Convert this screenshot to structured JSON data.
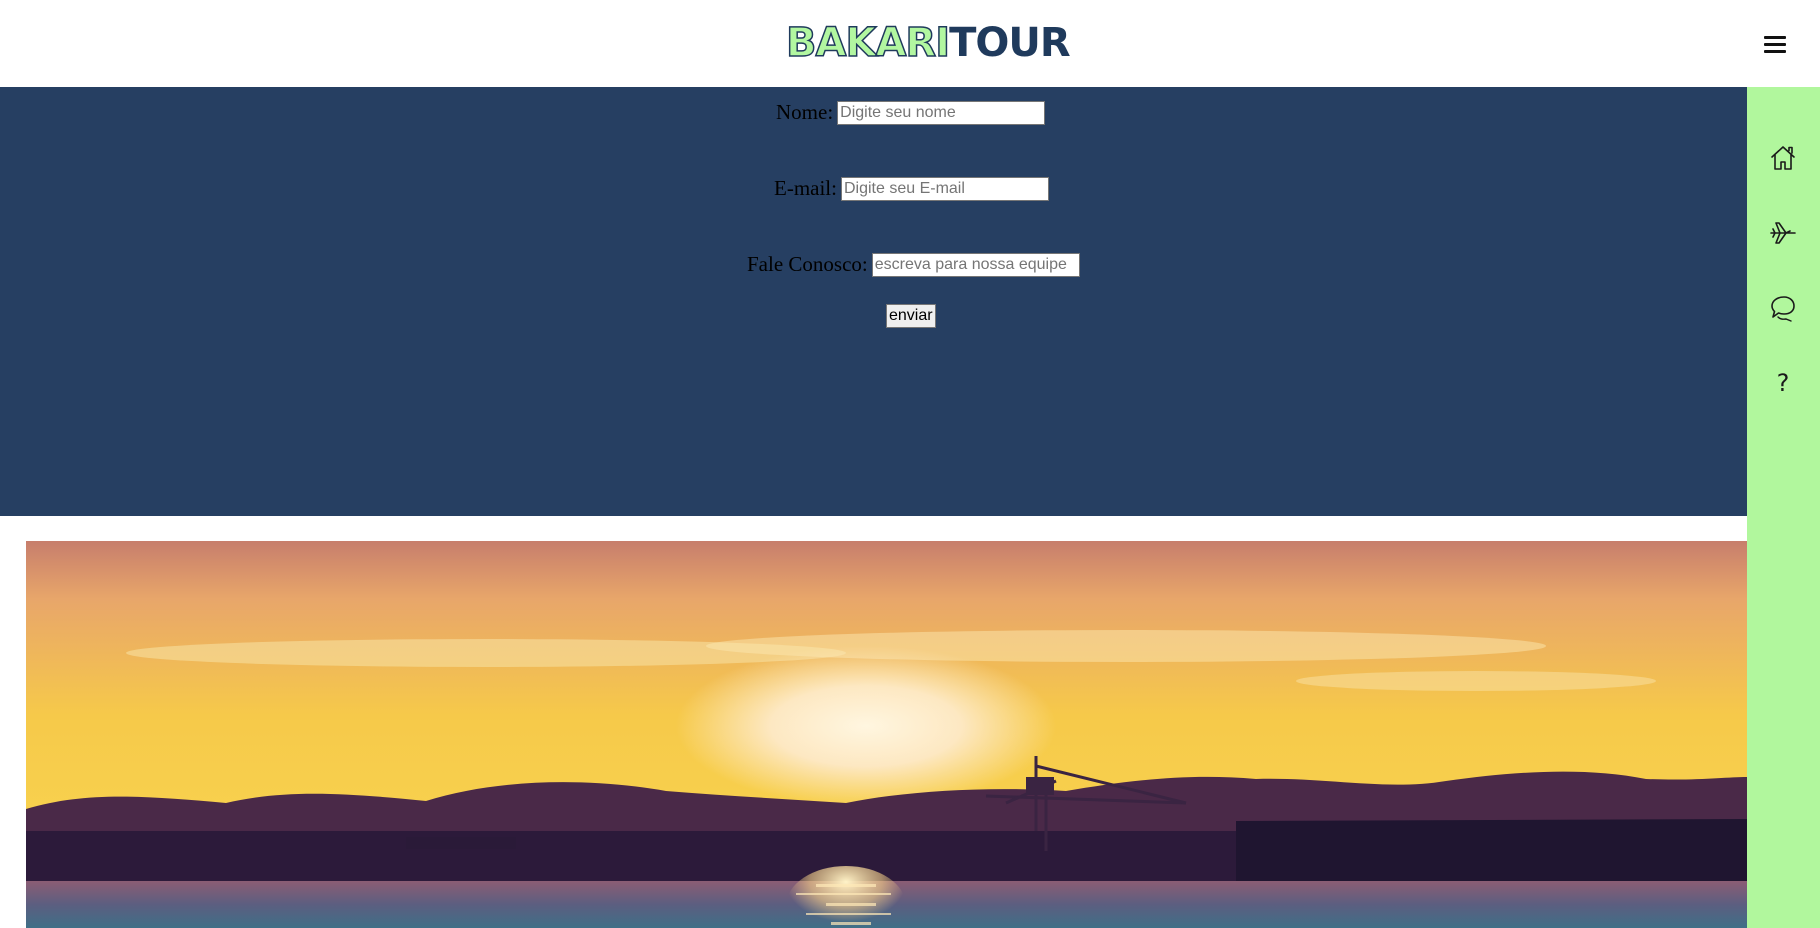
{
  "header": {
    "logo_part1": "BAKARI",
    "logo_part2": "TOUR",
    "menu_icon": "hamburger-menu-icon"
  },
  "form": {
    "name_label": "Nome:",
    "name_placeholder": "Digite seu nome",
    "name_value": "",
    "email_label": "E-mail:",
    "email_placeholder": "Digite seu E-mail",
    "email_value": "",
    "contact_label": "Fale Conosco:",
    "contact_placeholder": "escreva para nossa equipe",
    "contact_value": "",
    "submit_label": "enviar"
  },
  "sidebar": {
    "items": [
      {
        "icon": "home-icon"
      },
      {
        "icon": "airplane-icon"
      },
      {
        "icon": "chat-icon"
      },
      {
        "icon": "help-icon",
        "glyph": "?"
      }
    ]
  },
  "colors": {
    "form_background": "#263f62",
    "sidebar_background": "#b1f79d",
    "logo_green": "#b2f7a0",
    "logo_navy": "#1f3a5c"
  },
  "hero": {
    "image": "sunset-over-bay-photo"
  }
}
